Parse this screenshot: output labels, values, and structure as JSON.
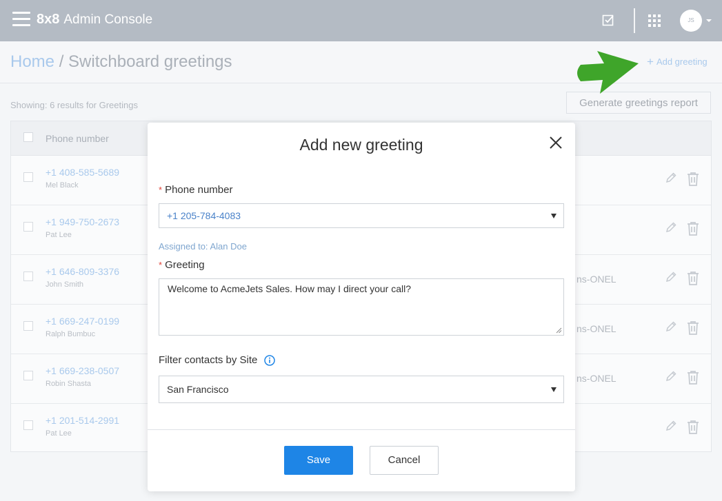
{
  "topbar": {
    "brand_logo": "8x8",
    "brand_name": "Admin Console",
    "avatar_initials": "JS"
  },
  "header": {
    "breadcrumb_home": "Home",
    "breadcrumb_sep": " / ",
    "breadcrumb_current": "Switchboard greetings",
    "add_label": "Add greeting"
  },
  "content": {
    "showing_text": "Showing: 6 results for Greetings",
    "report_button": "Generate greetings report",
    "column_phone": "Phone number",
    "rows": [
      {
        "number": "+1 408-585-5689",
        "name": "Mel Black",
        "right": ""
      },
      {
        "number": "+1 949-750-2673",
        "name": "Pat Lee",
        "right": ""
      },
      {
        "number": "+1 646-809-3376",
        "name": "John Smith",
        "right": "ns-ONEL"
      },
      {
        "number": "+1 669-247-0199",
        "name": "Ralph Bumbuc",
        "right": "ns-ONEL"
      },
      {
        "number": "+1 669-238-0507",
        "name": "Robin Shasta",
        "right": "ns-ONEL"
      },
      {
        "number": "+1 201-514-2991",
        "name": "Pat Lee",
        "right": ""
      }
    ]
  },
  "modal": {
    "title": "Add new greeting",
    "required_mark": "*",
    "phone_label": "Phone number",
    "phone_value": "+1 205-784-4083",
    "assigned_text": "Assigned to: Alan Doe",
    "greeting_label": "Greeting",
    "greeting_value": "Welcome to AcmeJets Sales. How may I direct your call?",
    "filter_label": "Filter contacts by Site",
    "site_value": "San Francisco",
    "save_label": "Save",
    "cancel_label": "Cancel"
  },
  "colors": {
    "primary": "#1e85e6",
    "link": "#a9c9ec",
    "required": "#e0453a",
    "annotation_arrow": "#3fa52a"
  }
}
